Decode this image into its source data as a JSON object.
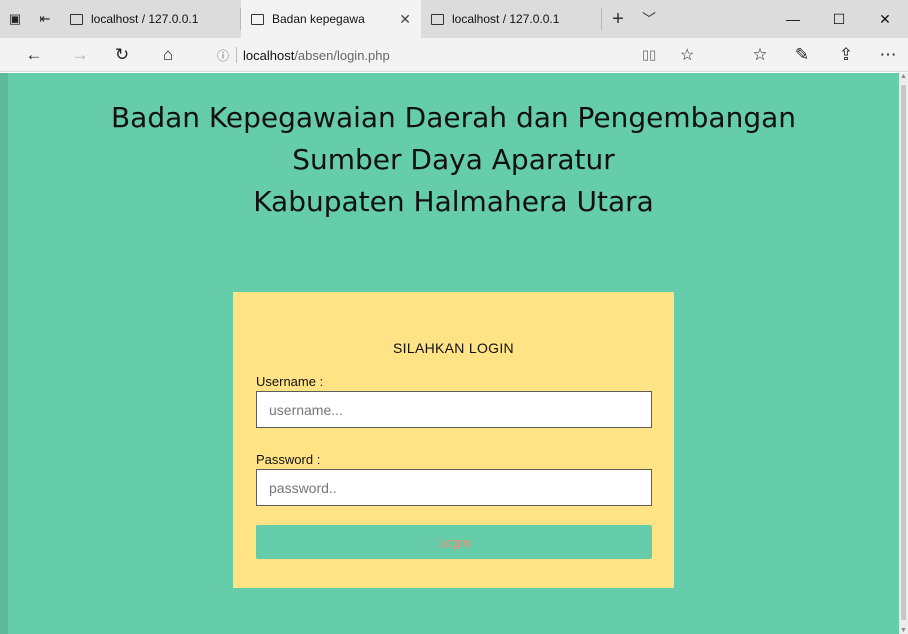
{
  "browser": {
    "tabs": [
      {
        "title": "localhost / 127.0.0.1",
        "active": false
      },
      {
        "title": "Badan kepegawa",
        "active": true
      },
      {
        "title": "localhost / 127.0.0.1",
        "active": false
      }
    ],
    "address": {
      "host": "localhost",
      "path": "/absen/login.php"
    }
  },
  "icons": {
    "tab_actions": "tab-set-aside-icon",
    "back": "back-arrow-icon",
    "forward": "forward-arrow-icon",
    "refresh": "refresh-icon",
    "home": "home-icon",
    "info": "site-info-icon",
    "reading_view": "reading-view-icon",
    "favorite": "star-icon",
    "favorites_hub": "favorites-list-icon",
    "notes": "pen-icon",
    "share": "share-icon",
    "more": "more-icon"
  },
  "page": {
    "heading": [
      "Badan Kepegawaian Daerah dan Pengembangan",
      "Sumber Daya Aparatur",
      "Kabupaten Halmahera Utara"
    ],
    "login": {
      "title": "SILAHKAN LOGIN",
      "username_label": "Username :",
      "username_placeholder": "username...",
      "password_label": "Password :",
      "password_placeholder": "password..",
      "button_label": "Login"
    }
  },
  "colors": {
    "background": "#66cdaa",
    "login_box": "#ffe385",
    "button_text": "#f08a6c"
  }
}
